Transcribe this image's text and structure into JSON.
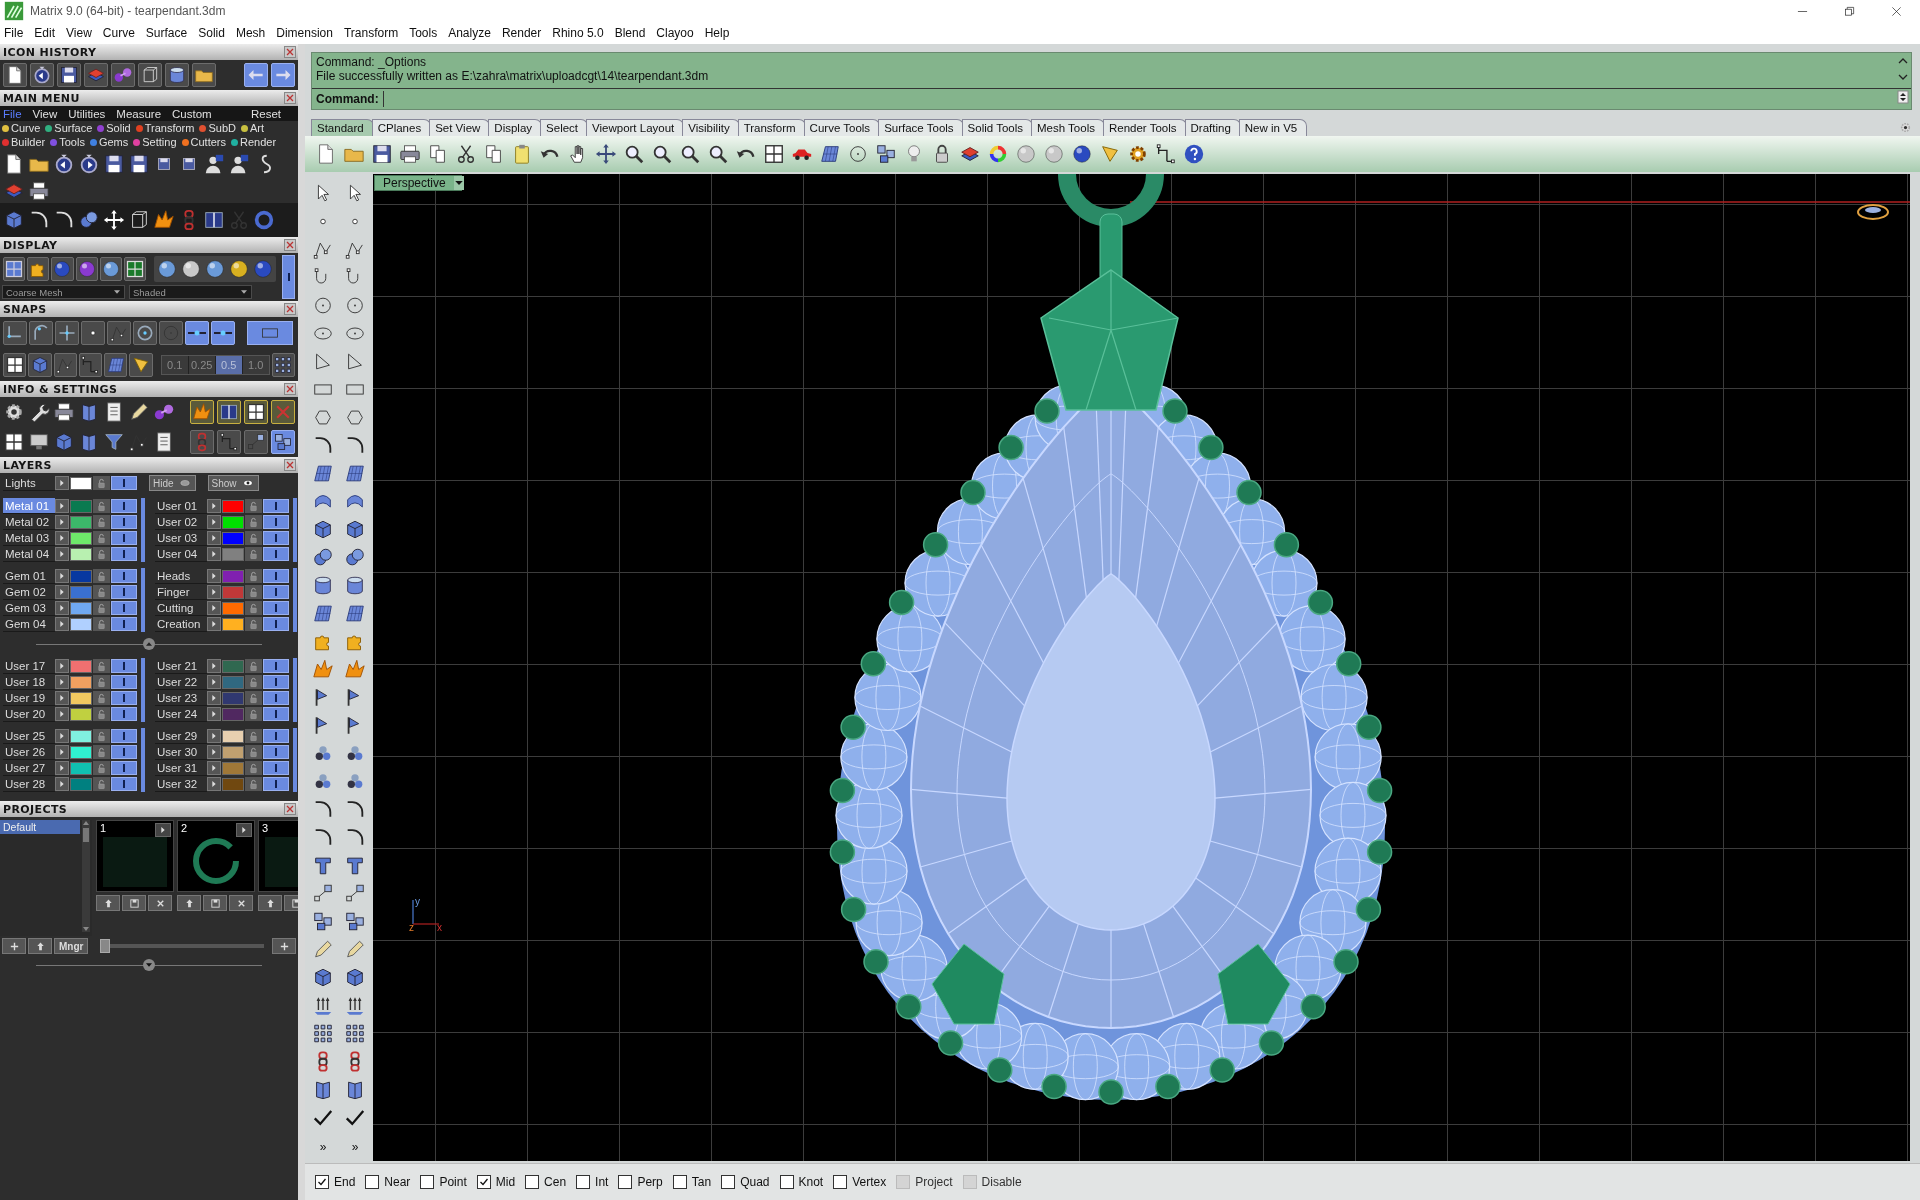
{
  "window": {
    "title": "Matrix 9.0 (64-bit) - tearpendant.3dm"
  },
  "menu_bar": [
    "File",
    "Edit",
    "View",
    "Curve",
    "Surface",
    "Solid",
    "Mesh",
    "Dimension",
    "Transform",
    "Tools",
    "Analyze",
    "Render",
    "Rhino 5.0",
    "Blend",
    "Clayoo",
    "Help"
  ],
  "left_panel": {
    "icon_history": {
      "title": "ICON HISTORY"
    },
    "main_menu": {
      "title": "MAIN MENU",
      "menu": [
        {
          "label": "File",
          "selected": true
        },
        {
          "label": "View",
          "selected": false
        },
        {
          "label": "Utilities",
          "selected": false
        },
        {
          "label": "Measure",
          "selected": false
        },
        {
          "label": "Custom",
          "selected": false
        },
        {
          "label": "Reset",
          "selected": false
        }
      ],
      "category_rows": [
        [
          {
            "label": "Curve",
            "color": "#e0c040"
          },
          {
            "label": "Surface",
            "color": "#30b080"
          },
          {
            "label": "Solid",
            "color": "#9040d0"
          },
          {
            "label": "Transform",
            "color": "#e04020"
          },
          {
            "label": "SubD",
            "color": "#e05030"
          },
          {
            "label": "Art",
            "color": "#c8c040"
          }
        ],
        [
          {
            "label": "Builder",
            "color": "#e03030"
          },
          {
            "label": "Tools",
            "color": "#8050e0"
          },
          {
            "label": "Gems",
            "color": "#4080e0"
          },
          {
            "label": "Setting",
            "color": "#e040a0"
          },
          {
            "label": "Cutters",
            "color": "#f07020"
          },
          {
            "label": "Render",
            "color": "#20b0a0"
          }
        ]
      ]
    },
    "display": {
      "title": "DISPLAY",
      "mesh_mode": "Coarse Mesh",
      "shading_mode": "Shaded"
    },
    "snaps": {
      "title": "SNAPS",
      "tolerances": [
        {
          "label": "0.1",
          "selected": false
        },
        {
          "label": "0.25",
          "selected": false
        },
        {
          "label": "0.5",
          "selected": true
        },
        {
          "label": "1.0",
          "selected": false
        }
      ]
    },
    "info_settings": {
      "title": "INFO & SETTINGS"
    },
    "layers": {
      "title": "LAYERS",
      "lights": {
        "label": "Lights",
        "color": "#ffffff",
        "visible": true
      },
      "hide_button": "Hide",
      "show_button": "Show",
      "groups": [
        {
          "left": [
            {
              "name": "Metal 01",
              "color": "#0a7a50",
              "selected": true,
              "visible": true
            },
            {
              "name": "Metal 02",
              "color": "#3cb86a",
              "selected": false,
              "visible": true
            },
            {
              "name": "Metal 03",
              "color": "#6ee86a",
              "selected": false,
              "visible": true
            },
            {
              "name": "Metal 04",
              "color": "#b8f0b0",
              "selected": false,
              "visible": true
            }
          ],
          "right": [
            {
              "name": "User 01",
              "color": "#ff0000",
              "selected": false,
              "visible": true
            },
            {
              "name": "User 02",
              "color": "#00e000",
              "selected": false,
              "visible": true
            },
            {
              "name": "User 03",
              "color": "#0000ff",
              "selected": false,
              "visible": true
            },
            {
              "name": "User 04",
              "color": "#808080",
              "selected": false,
              "visible": true
            }
          ]
        },
        {
          "left": [
            {
              "name": "Gem 01",
              "color": "#0838a0",
              "selected": false,
              "visible": true
            },
            {
              "name": "Gem 02",
              "color": "#3a70d0",
              "selected": false,
              "visible": true
            },
            {
              "name": "Gem 03",
              "color": "#70a8f0",
              "selected": false,
              "visible": true
            },
            {
              "name": "Gem 04",
              "color": "#b0d0ff",
              "selected": false,
              "visible": true
            }
          ],
          "right": [
            {
              "name": "Heads",
              "color": "#8020b0",
              "selected": false,
              "visible": true
            },
            {
              "name": "Finger",
              "color": "#c03838",
              "selected": false,
              "visible": true
            },
            {
              "name": "Cutting",
              "color": "#ff6a00",
              "selected": false,
              "visible": true
            },
            {
              "name": "Creation",
              "color": "#ffb020",
              "selected": false,
              "visible": true
            }
          ]
        },
        {
          "left": [
            {
              "name": "User 17",
              "color": "#f07070",
              "selected": false,
              "visible": true
            },
            {
              "name": "User 18",
              "color": "#f0a060",
              "selected": false,
              "visible": true
            },
            {
              "name": "User 19",
              "color": "#f0c860",
              "selected": false,
              "visible": true
            },
            {
              "name": "User 20",
              "color": "#c0d040",
              "selected": false,
              "visible": true
            }
          ],
          "right": [
            {
              "name": "User 21",
              "color": "#306850",
              "selected": false,
              "visible": true
            },
            {
              "name": "User 22",
              "color": "#306880",
              "selected": false,
              "visible": true
            },
            {
              "name": "User 23",
              "color": "#303870",
              "selected": false,
              "visible": true
            },
            {
              "name": "User 24",
              "color": "#502860",
              "selected": false,
              "visible": true
            }
          ]
        },
        {
          "left": [
            {
              "name": "User 25",
              "color": "#80f0e0",
              "selected": false,
              "visible": true
            },
            {
              "name": "User 26",
              "color": "#30f0d0",
              "selected": false,
              "visible": true
            },
            {
              "name": "User 27",
              "color": "#10c0b0",
              "selected": false,
              "visible": true
            },
            {
              "name": "User 28",
              "color": "#008080",
              "selected": false,
              "visible": true
            }
          ],
          "right": [
            {
              "name": "User 29",
              "color": "#e8d0b0",
              "selected": false,
              "visible": true
            },
            {
              "name": "User 30",
              "color": "#c0a070",
              "selected": false,
              "visible": true
            },
            {
              "name": "User 31",
              "color": "#a07838",
              "selected": false,
              "visible": true
            },
            {
              "name": "User 32",
              "color": "#704810",
              "selected": false,
              "visible": true
            }
          ]
        }
      ]
    },
    "projects": {
      "title": "PROJECTS",
      "list": [
        {
          "label": "Default",
          "selected": true
        }
      ],
      "thumbnails": [
        {
          "number": "1"
        },
        {
          "number": "2"
        },
        {
          "number": "3"
        }
      ],
      "manager_button": "Mngr",
      "slider": {
        "level": 0
      }
    }
  },
  "command": {
    "history": [
      "Command: _Options",
      "File successfully written as E:\\zahra\\matrix\\uploadcgt\\14\\tearpendant.3dm"
    ],
    "prompt": "Command:"
  },
  "toolbar_tabs": [
    {
      "label": "Standard",
      "selected": true
    },
    {
      "label": "CPlanes",
      "selected": false
    },
    {
      "label": "Set View",
      "selected": false
    },
    {
      "label": "Display",
      "selected": false
    },
    {
      "label": "Select",
      "selected": false
    },
    {
      "label": "Viewport Layout",
      "selected": false
    },
    {
      "label": "Visibility",
      "selected": false
    },
    {
      "label": "Transform",
      "selected": false
    },
    {
      "label": "Curve Tools",
      "selected": false
    },
    {
      "label": "Surface Tools",
      "selected": false
    },
    {
      "label": "Solid Tools",
      "selected": false
    },
    {
      "label": "Mesh Tools",
      "selected": false
    },
    {
      "label": "Render Tools",
      "selected": false
    },
    {
      "label": "Drafting",
      "selected": false
    },
    {
      "label": "New in V5",
      "selected": false
    }
  ],
  "side_toolbar": {
    "overflow": [
      "»",
      "»"
    ]
  },
  "viewport": {
    "label": "Perspective",
    "axis_labels": [
      "y",
      "z",
      "x"
    ]
  },
  "status_bar": {
    "snaps": [
      {
        "label": "End",
        "checked": true,
        "disabled": false
      },
      {
        "label": "Near",
        "checked": false,
        "disabled": false
      },
      {
        "label": "Point",
        "checked": false,
        "disabled": false
      },
      {
        "label": "Mid",
        "checked": true,
        "disabled": false
      },
      {
        "label": "Cen",
        "checked": false,
        "disabled": false
      },
      {
        "label": "Int",
        "checked": false,
        "disabled": false
      },
      {
        "label": "Perp",
        "checked": false,
        "disabled": false
      },
      {
        "label": "Tan",
        "checked": false,
        "disabled": false
      },
      {
        "label": "Quad",
        "checked": false,
        "disabled": false
      },
      {
        "label": "Knot",
        "checked": false,
        "disabled": false
      },
      {
        "label": "Vertex",
        "checked": false,
        "disabled": false
      },
      {
        "label": "Project",
        "checked": false,
        "disabled": true
      },
      {
        "label": "Disable",
        "checked": false,
        "disabled": true
      }
    ]
  }
}
